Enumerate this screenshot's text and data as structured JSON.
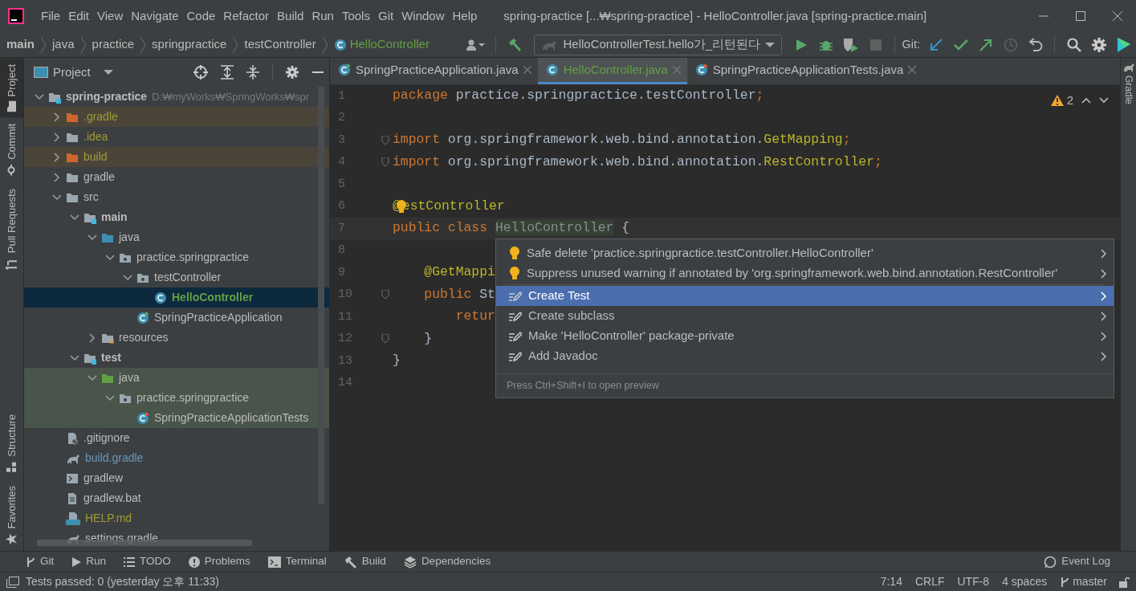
{
  "window": {
    "title": "spring-practice [...₩spring-practice] - HelloController.java [spring-practice.main]"
  },
  "menu": [
    "File",
    "Edit",
    "View",
    "Navigate",
    "Code",
    "Refactor",
    "Build",
    "Run",
    "Tools",
    "Git",
    "Window",
    "Help"
  ],
  "breadcrumbs": [
    {
      "label": "main",
      "kind": "module"
    },
    {
      "label": "java",
      "kind": "folder"
    },
    {
      "label": "practice",
      "kind": "folder"
    },
    {
      "label": "springpractice",
      "kind": "folder"
    },
    {
      "label": "testController",
      "kind": "folder"
    },
    {
      "label": "HelloController",
      "kind": "class"
    }
  ],
  "toolbar": {
    "run_configuration": "HelloControllerTest.hello가_리턴된다",
    "git_label": "Git:"
  },
  "left_tool_strip": {
    "top": [
      {
        "label": "Project",
        "kind": "project",
        "selected": true
      },
      {
        "label": "Commit",
        "kind": "commit",
        "selected": false
      },
      {
        "label": "Pull Requests",
        "kind": "pull-requests",
        "selected": false
      }
    ],
    "bottom": [
      {
        "label": "Structure",
        "kind": "structure",
        "selected": false
      },
      {
        "label": "Favorites",
        "kind": "favorites",
        "selected": false
      }
    ]
  },
  "right_tool_strip": [
    {
      "label": "Gradle",
      "selected": false
    }
  ],
  "project_panel": {
    "title": "Project",
    "tree": [
      {
        "label": "spring-practice",
        "path": "D:₩myWorks₩SpringWorks₩spr",
        "kind": "module",
        "color": "#bbbbbb",
        "test_source": false,
        "expanded": true,
        "selected": false,
        "children": [
          {
            "label": ".gradle",
            "kind": "excluded",
            "color": "#a09c38",
            "test_source": false,
            "expanded": false,
            "selected": false
          },
          {
            "label": ".idea",
            "kind": "folder",
            "color": "#a09c38",
            "test_source": false,
            "expanded": false,
            "selected": false
          },
          {
            "label": "build",
            "kind": "excluded",
            "color": "#a09c38",
            "test_source": false,
            "expanded": false,
            "selected": false
          },
          {
            "label": "gradle",
            "kind": "folder",
            "color": "#bbbbbb",
            "test_source": false,
            "expanded": false,
            "selected": false
          },
          {
            "label": "src",
            "kind": "folder",
            "color": "#bbbbbb",
            "test_source": false,
            "expanded": true,
            "selected": false,
            "children": [
              {
                "label": "main",
                "kind": "module",
                "color": "#bbbbbb",
                "test_source": false,
                "expanded": true,
                "selected": false,
                "children": [
                  {
                    "label": "java",
                    "kind": "source-root",
                    "color": "#bbbbbb",
                    "test_source": false,
                    "expanded": true,
                    "selected": false,
                    "children": [
                      {
                        "label": "practice.springpractice",
                        "kind": "package",
                        "color": "#bbbbbb",
                        "test_source": false,
                        "expanded": true,
                        "selected": false,
                        "children": [
                          {
                            "label": "testController",
                            "kind": "package",
                            "color": "#bbbbbb",
                            "test_source": false,
                            "expanded": true,
                            "selected": false,
                            "children": [
                              {
                                "label": "HelloController",
                                "kind": "class",
                                "color": "#62a044",
                                "test_source": false,
                                "selected": true
                              }
                            ]
                          },
                          {
                            "label": "SpringPracticeApplication",
                            "kind": "main-class",
                            "color": "#bbbbbb",
                            "test_source": false,
                            "selected": false
                          }
                        ]
                      }
                    ]
                  },
                  {
                    "label": "resources",
                    "kind": "resources-root",
                    "color": "#bbbbbb",
                    "test_source": false,
                    "expanded": false,
                    "selected": false
                  }
                ]
              },
              {
                "label": "test",
                "kind": "module",
                "color": "#bbbbbb",
                "test_source": false,
                "expanded": true,
                "selected": false,
                "children": [
                  {
                    "label": "java",
                    "kind": "test-root",
                    "color": "#bbbbbb",
                    "test_source": true,
                    "expanded": true,
                    "selected": false,
                    "children": [
                      {
                        "label": "practice.springpractice",
                        "kind": "package",
                        "color": "#bbbbbb",
                        "test_source": true,
                        "expanded": true,
                        "selected": false,
                        "children": [
                          {
                            "label": "SpringPracticeApplicationTests",
                            "kind": "test-class",
                            "color": "#bbbbbb",
                            "test_source": true,
                            "selected": false
                          }
                        ]
                      }
                    ]
                  }
                ]
              }
            ]
          },
          {
            "label": ".gitignore",
            "kind": "ignore-file",
            "color": "#bbbbbb",
            "test_source": false,
            "selected": false
          },
          {
            "label": "build.gradle",
            "kind": "gradle-file",
            "color": "#6897bb",
            "test_source": false,
            "selected": false
          },
          {
            "label": "gradlew",
            "kind": "script",
            "color": "#bbbbbb",
            "test_source": false,
            "selected": false
          },
          {
            "label": "gradlew.bat",
            "kind": "text-file",
            "color": "#bbbbbb",
            "test_source": false,
            "selected": false
          },
          {
            "label": "HELP.md",
            "kind": "markdown",
            "color": "#a09c38",
            "test_source": false,
            "selected": false
          },
          {
            "label": "settings.gradle",
            "kind": "gradle-file",
            "color": "#bbbbbb",
            "test_source": false,
            "selected": false
          }
        ]
      }
    ]
  },
  "tabs": [
    {
      "label": "SpringPracticeApplication.java",
      "kind": "main-class",
      "color": "#bbbbbb",
      "selected": false
    },
    {
      "label": "HelloController.java",
      "kind": "class",
      "color": "#62a044",
      "selected": true
    },
    {
      "label": "SpringPracticeApplicationTests.java",
      "kind": "test-class",
      "color": "#bbbbbb",
      "selected": false
    }
  ],
  "editor": {
    "warnings": "2",
    "lines": [
      {
        "number": "1",
        "tokens": [
          {
            "kind": "keyword",
            "text": "package"
          },
          {
            "kind": "plain",
            "text": " practice.springpractice.testController"
          },
          {
            "kind": "keyword",
            "text": ";"
          }
        ]
      },
      {
        "number": "2"
      },
      {
        "number": "3",
        "fold": true,
        "tokens": [
          {
            "kind": "keyword",
            "text": "import"
          },
          {
            "kind": "plain",
            "text": " org.springframework.web.bind.annotation."
          },
          {
            "kind": "annotation",
            "text": "GetMapping"
          },
          {
            "kind": "keyword",
            "text": ";"
          }
        ]
      },
      {
        "number": "4",
        "fold": true,
        "tokens": [
          {
            "kind": "keyword",
            "text": "import"
          },
          {
            "kind": "plain",
            "text": " org.springframework.web.bind.annotation."
          },
          {
            "kind": "annotation",
            "text": "RestController"
          },
          {
            "kind": "keyword",
            "text": ";"
          }
        ]
      },
      {
        "number": "5"
      },
      {
        "number": "6",
        "tokens": [
          {
            "kind": "annotation",
            "text": "@"
          },
          {
            "kind": "bulb"
          },
          {
            "kind": "annotation",
            "text": "estController"
          }
        ]
      },
      {
        "number": "7",
        "current": true,
        "tokens": [
          {
            "kind": "keyword",
            "text": "public class "
          },
          {
            "kind": "unused",
            "text": "HelloController"
          },
          {
            "kind": "plain",
            "text": " {"
          }
        ]
      },
      {
        "number": "8"
      },
      {
        "number": "9",
        "tokens": [
          {
            "kind": "annotation",
            "text": "    @GetMappi"
          }
        ]
      },
      {
        "number": "10",
        "fold": true,
        "tokens": [
          {
            "kind": "keyword",
            "text": "    public"
          },
          {
            "kind": "plain",
            "text": " St"
          }
        ]
      },
      {
        "number": "11",
        "tokens": [
          {
            "kind": "keyword",
            "text": "        retur"
          }
        ]
      },
      {
        "number": "12",
        "fold": true,
        "tokens": [
          {
            "kind": "plain",
            "text": "    }"
          }
        ]
      },
      {
        "number": "13",
        "tokens": [
          {
            "kind": "plain",
            "text": "}"
          }
        ]
      },
      {
        "number": "14"
      }
    ]
  },
  "intention_menu": {
    "items": [
      {
        "label": "Safe delete 'practice.springpractice.testController.HelloController'",
        "kind": "bulb",
        "selected": false
      },
      {
        "label": "Suppress unused warning if annotated by 'org.springframework.web.bind.annotation.RestController'",
        "kind": "bulb",
        "selected": false
      },
      {
        "label": "Create Test",
        "kind": "intention",
        "selected": true
      },
      {
        "label": "Create subclass",
        "kind": "intention",
        "selected": false
      },
      {
        "label": "Make 'HelloController' package-private",
        "kind": "intention",
        "selected": false
      },
      {
        "label": "Add Javadoc",
        "kind": "intention",
        "selected": false
      }
    ],
    "hint": "Press Ctrl+Shift+I to open preview"
  },
  "tool_windows": [
    {
      "label": "Git",
      "kind": "git"
    },
    {
      "label": "Run",
      "kind": "run"
    },
    {
      "label": "TODO",
      "kind": "todo"
    },
    {
      "label": "Problems",
      "kind": "problems"
    },
    {
      "label": "Terminal",
      "kind": "terminal"
    },
    {
      "label": "Build",
      "kind": "build"
    },
    {
      "label": "Dependencies",
      "kind": "dependencies"
    }
  ],
  "event_log": "Event Log",
  "status_bar": {
    "message": "Tests passed: 0 (yesterday 오후 11:33)",
    "position": "7:14",
    "line_separator": "CRLF",
    "encoding": "UTF-8",
    "indent": "4 spaces",
    "branch": "master"
  }
}
